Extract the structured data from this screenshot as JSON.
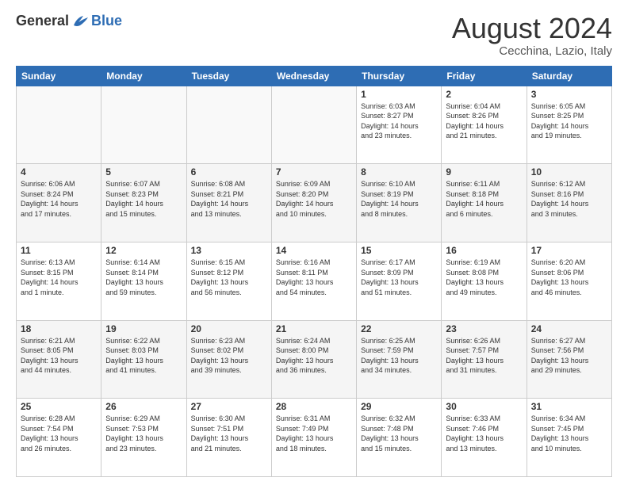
{
  "logo": {
    "general": "General",
    "blue": "Blue"
  },
  "title": "August 2024",
  "subtitle": "Cecchina, Lazio, Italy",
  "headers": [
    "Sunday",
    "Monday",
    "Tuesday",
    "Wednesday",
    "Thursday",
    "Friday",
    "Saturday"
  ],
  "weeks": [
    [
      {
        "day": "",
        "info": ""
      },
      {
        "day": "",
        "info": ""
      },
      {
        "day": "",
        "info": ""
      },
      {
        "day": "",
        "info": ""
      },
      {
        "day": "1",
        "info": "Sunrise: 6:03 AM\nSunset: 8:27 PM\nDaylight: 14 hours\nand 23 minutes."
      },
      {
        "day": "2",
        "info": "Sunrise: 6:04 AM\nSunset: 8:26 PM\nDaylight: 14 hours\nand 21 minutes."
      },
      {
        "day": "3",
        "info": "Sunrise: 6:05 AM\nSunset: 8:25 PM\nDaylight: 14 hours\nand 19 minutes."
      }
    ],
    [
      {
        "day": "4",
        "info": "Sunrise: 6:06 AM\nSunset: 8:24 PM\nDaylight: 14 hours\nand 17 minutes."
      },
      {
        "day": "5",
        "info": "Sunrise: 6:07 AM\nSunset: 8:23 PM\nDaylight: 14 hours\nand 15 minutes."
      },
      {
        "day": "6",
        "info": "Sunrise: 6:08 AM\nSunset: 8:21 PM\nDaylight: 14 hours\nand 13 minutes."
      },
      {
        "day": "7",
        "info": "Sunrise: 6:09 AM\nSunset: 8:20 PM\nDaylight: 14 hours\nand 10 minutes."
      },
      {
        "day": "8",
        "info": "Sunrise: 6:10 AM\nSunset: 8:19 PM\nDaylight: 14 hours\nand 8 minutes."
      },
      {
        "day": "9",
        "info": "Sunrise: 6:11 AM\nSunset: 8:18 PM\nDaylight: 14 hours\nand 6 minutes."
      },
      {
        "day": "10",
        "info": "Sunrise: 6:12 AM\nSunset: 8:16 PM\nDaylight: 14 hours\nand 3 minutes."
      }
    ],
    [
      {
        "day": "11",
        "info": "Sunrise: 6:13 AM\nSunset: 8:15 PM\nDaylight: 14 hours\nand 1 minute."
      },
      {
        "day": "12",
        "info": "Sunrise: 6:14 AM\nSunset: 8:14 PM\nDaylight: 13 hours\nand 59 minutes."
      },
      {
        "day": "13",
        "info": "Sunrise: 6:15 AM\nSunset: 8:12 PM\nDaylight: 13 hours\nand 56 minutes."
      },
      {
        "day": "14",
        "info": "Sunrise: 6:16 AM\nSunset: 8:11 PM\nDaylight: 13 hours\nand 54 minutes."
      },
      {
        "day": "15",
        "info": "Sunrise: 6:17 AM\nSunset: 8:09 PM\nDaylight: 13 hours\nand 51 minutes."
      },
      {
        "day": "16",
        "info": "Sunrise: 6:19 AM\nSunset: 8:08 PM\nDaylight: 13 hours\nand 49 minutes."
      },
      {
        "day": "17",
        "info": "Sunrise: 6:20 AM\nSunset: 8:06 PM\nDaylight: 13 hours\nand 46 minutes."
      }
    ],
    [
      {
        "day": "18",
        "info": "Sunrise: 6:21 AM\nSunset: 8:05 PM\nDaylight: 13 hours\nand 44 minutes."
      },
      {
        "day": "19",
        "info": "Sunrise: 6:22 AM\nSunset: 8:03 PM\nDaylight: 13 hours\nand 41 minutes."
      },
      {
        "day": "20",
        "info": "Sunrise: 6:23 AM\nSunset: 8:02 PM\nDaylight: 13 hours\nand 39 minutes."
      },
      {
        "day": "21",
        "info": "Sunrise: 6:24 AM\nSunset: 8:00 PM\nDaylight: 13 hours\nand 36 minutes."
      },
      {
        "day": "22",
        "info": "Sunrise: 6:25 AM\nSunset: 7:59 PM\nDaylight: 13 hours\nand 34 minutes."
      },
      {
        "day": "23",
        "info": "Sunrise: 6:26 AM\nSunset: 7:57 PM\nDaylight: 13 hours\nand 31 minutes."
      },
      {
        "day": "24",
        "info": "Sunrise: 6:27 AM\nSunset: 7:56 PM\nDaylight: 13 hours\nand 29 minutes."
      }
    ],
    [
      {
        "day": "25",
        "info": "Sunrise: 6:28 AM\nSunset: 7:54 PM\nDaylight: 13 hours\nand 26 minutes."
      },
      {
        "day": "26",
        "info": "Sunrise: 6:29 AM\nSunset: 7:53 PM\nDaylight: 13 hours\nand 23 minutes."
      },
      {
        "day": "27",
        "info": "Sunrise: 6:30 AM\nSunset: 7:51 PM\nDaylight: 13 hours\nand 21 minutes."
      },
      {
        "day": "28",
        "info": "Sunrise: 6:31 AM\nSunset: 7:49 PM\nDaylight: 13 hours\nand 18 minutes."
      },
      {
        "day": "29",
        "info": "Sunrise: 6:32 AM\nSunset: 7:48 PM\nDaylight: 13 hours\nand 15 minutes."
      },
      {
        "day": "30",
        "info": "Sunrise: 6:33 AM\nSunset: 7:46 PM\nDaylight: 13 hours\nand 13 minutes."
      },
      {
        "day": "31",
        "info": "Sunrise: 6:34 AM\nSunset: 7:45 PM\nDaylight: 13 hours\nand 10 minutes."
      }
    ]
  ],
  "colors": {
    "header_bg": "#2e6db4",
    "header_text": "#ffffff",
    "border": "#cccccc",
    "alt_row": "#f5f5f5"
  }
}
